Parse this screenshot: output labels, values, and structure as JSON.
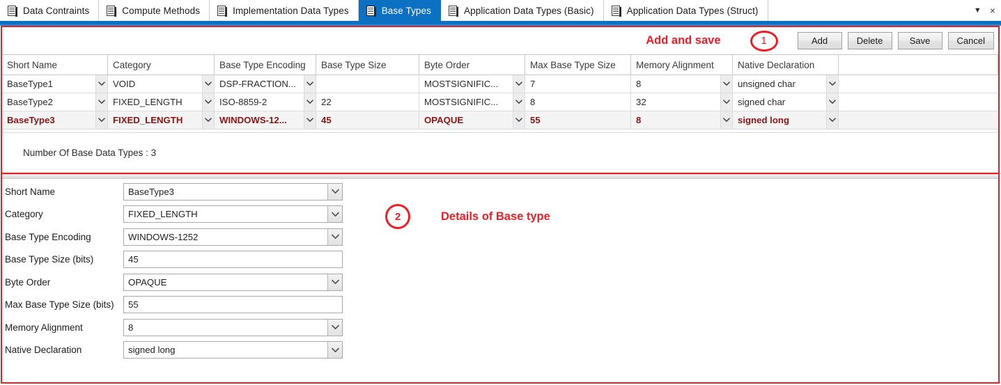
{
  "tabs": [
    {
      "label": "Data Contraints",
      "active": false
    },
    {
      "label": "Compute Methods",
      "active": false
    },
    {
      "label": "Implementation Data Types",
      "active": false
    },
    {
      "label": "Base Types",
      "active": true
    },
    {
      "label": "Application Data Types (Basic)",
      "active": false
    },
    {
      "label": "Application Data Types (Struct)",
      "active": false
    }
  ],
  "tabbar": {
    "overflow_icon": "chevron-down-icon",
    "overflow_glyph": "▼",
    "close_glyph": "×"
  },
  "toolbar": {
    "annotation_label": "Add and save",
    "annotation_number": "1",
    "buttons": [
      {
        "label": "Add"
      },
      {
        "label": "Delete"
      },
      {
        "label": "Save"
      },
      {
        "label": "Cancel"
      }
    ]
  },
  "grid": {
    "columns": [
      "Short Name",
      "Category",
      "Base Type Encoding",
      "Base Type Size",
      "Byte Order",
      "Max Base Type Size",
      "Memory Alignment",
      "Native Declaration",
      ""
    ],
    "rows": [
      {
        "selected": false,
        "cells": [
          "BaseType1",
          "VOID",
          "DSP-FRACTION...",
          "",
          "MOSTSIGNIFIC...",
          "7",
          "8",
          "unsigned char",
          ""
        ]
      },
      {
        "selected": false,
        "cells": [
          "BaseType2",
          "FIXED_LENGTH",
          "ISO-8859-2",
          "22",
          "MOSTSIGNIFIC...",
          "8",
          "32",
          "signed char",
          ""
        ]
      },
      {
        "selected": true,
        "cells": [
          "BaseType3",
          "FIXED_LENGTH",
          "WINDOWS-12...",
          "45",
          "OPAQUE",
          "55",
          "8",
          "signed long",
          ""
        ]
      }
    ]
  },
  "count_text": "Number Of Base Data Types : 3",
  "detail": {
    "annotation_number": "2",
    "annotation_label": "Details of Base type",
    "fields": [
      {
        "label": "Short Name",
        "value": "BaseType3",
        "has_dropdown": true
      },
      {
        "label": "Category",
        "value": "FIXED_LENGTH",
        "has_dropdown": true
      },
      {
        "label": "Base Type Encoding",
        "value": "WINDOWS-1252",
        "has_dropdown": true
      },
      {
        "label": "Base Type Size (bits)",
        "value": "45",
        "has_dropdown": false
      },
      {
        "label": "Byte Order",
        "value": "OPAQUE",
        "has_dropdown": true
      },
      {
        "label": "Max Base Type Size (bits)",
        "value": "55",
        "has_dropdown": false
      },
      {
        "label": "Memory Alignment",
        "value": "8",
        "has_dropdown": true
      },
      {
        "label": "Native Declaration",
        "value": "signed long",
        "has_dropdown": true
      }
    ]
  },
  "colors": {
    "accent_blue": "#0c71c3",
    "annotation_red": "#ee1c25",
    "selected_row_text": "#8a1515"
  }
}
